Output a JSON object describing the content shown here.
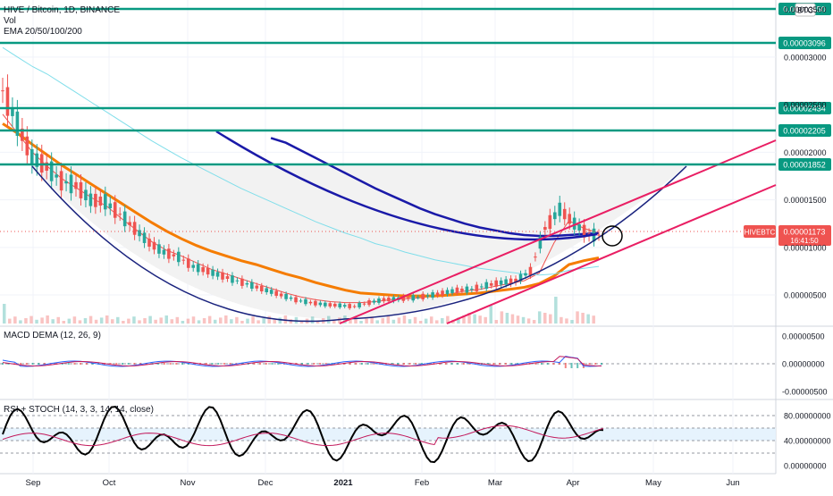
{
  "header": {
    "symbol_line": "HIVE / Bitcoin, 1D, BINANCE",
    "vol_label": "Vol",
    "ema_label": "EMA 20/50/100/200",
    "currency_badge": "BTC"
  },
  "macd_panel": {
    "title": "MACD DEMA (12, 26, 9)",
    "ticks": [
      "0.00000500",
      "0.00000000",
      "-0.00000500"
    ]
  },
  "rsi_panel": {
    "title": "RSI + STOCH (14, 3, 3, 14, 14, close)",
    "ticks": [
      "80.00000000",
      "40.00000000",
      "0.00000000"
    ]
  },
  "price_axis": {
    "ticks": [
      "0.00003500",
      "0.00003000",
      "0.00002500",
      "0.00002000",
      "0.00001500",
      "0.00001000",
      "0.00000500"
    ]
  },
  "horizontal_levels": [
    {
      "label": "0.00003650",
      "value": 3.65e-05
    },
    {
      "label": "0.00003096",
      "value": 3.096e-05
    },
    {
      "label": "0.00002434",
      "value": 2.434e-05
    },
    {
      "label": "0.00002205",
      "value": 2.205e-05
    },
    {
      "label": "0.00001852",
      "value": 1.852e-05
    }
  ],
  "current_price": {
    "symbol": "HIVEBTC",
    "value_label": "0.00001173",
    "countdown": "16:41:50",
    "value": 1.173e-05
  },
  "time_axis": {
    "labels": [
      "Sep",
      "Oct",
      "Nov",
      "Dec",
      "2021",
      "Feb",
      "Mar",
      "Apr",
      "May",
      "Jun"
    ]
  },
  "colors": {
    "level_line": "#089981",
    "level_label_bg": "#089981",
    "channel": "#e91e63",
    "curve": "#1a237e",
    "ema20": "#ef5350",
    "ema50": "#f57c00",
    "ema100": "#80deea",
    "ema200": "#1a1aa8",
    "up": "#26a69a",
    "down": "#ef5350",
    "price_badge": "#ef5350",
    "stoch": "#000000",
    "rsi": "#c2185b"
  },
  "chart_data": {
    "type": "line",
    "title": "HIVE / Bitcoin, 1D, BINANCE",
    "x_label_axis": [
      "Sep",
      "Oct",
      "Nov",
      "Dec",
      "2021",
      "Feb",
      "Mar",
      "Apr",
      "May",
      "Jun"
    ],
    "ylim": [
      2e-06,
      3.6e-05
    ],
    "price_close_approx": [
      2.65e-05,
      2.3e-05,
      1.95e-05,
      1.85e-05,
      1.7e-05,
      1.65e-05,
      1.5e-05,
      1.48e-05,
      1.35e-05,
      1.2e-05,
      1.05e-05,
      9.5e-06,
      9e-06,
      8e-06,
      7.5e-06,
      7e-06,
      6.5e-06,
      6e-06,
      5.5e-06,
      5e-06,
      4.5e-06,
      4.2e-06,
      4e-06,
      3.9e-06,
      3.8e-06,
      4.2e-06,
      4.5e-06,
      4.6e-06,
      4.7e-06,
      4.9e-06,
      5.2e-06,
      5.5e-06,
      5.6e-06,
      6e-06,
      6.3e-06,
      6.5e-06,
      7.5e-06,
      1.2e-05,
      1.4e-05,
      1.25e-05,
      1.13e-05
    ],
    "series": [
      {
        "name": "EMA 20",
        "values": [
          2.4e-05,
          2.2e-05,
          2e-05,
          1.85e-05,
          1.72e-05,
          1.62e-05,
          1.52e-05,
          1.43e-05,
          1.3e-05,
          1.18e-05,
          1.06e-05,
          9.7e-06,
          9.1e-06,
          8.4e-06,
          7.7e-06,
          7.2e-06,
          6.7e-06,
          6.2e-06,
          5.7e-06,
          5.2e-06,
          4.8e-06,
          4.5e-06,
          4.3e-06,
          4.2e-06,
          4.2e-06,
          4.3e-06,
          4.5e-06,
          4.6e-06,
          4.7e-06,
          4.9e-06,
          5.1e-06,
          5.4e-06,
          5.6e-06,
          5.9e-06,
          6.2e-06,
          6.5e-06,
          7.3e-06,
          1.05e-05,
          1.28e-05,
          1.2e-05,
          1.15e-05
        ]
      },
      {
        "name": "EMA 50",
        "values": [
          2.3e-05,
          2.2e-05,
          2.08e-05,
          1.97e-05,
          1.86e-05,
          1.76e-05,
          1.66e-05,
          1.56e-05,
          1.46e-05,
          1.36e-05,
          1.26e-05,
          1.17e-05,
          1.09e-05,
          1.02e-05,
          9.6e-06,
          9.1e-06,
          8.6e-06,
          8.2e-06,
          7.7e-06,
          7.2e-06,
          6.8e-06,
          6.3e-06,
          5.9e-06,
          5.5e-06,
          5.2e-06,
          5.1e-06,
          5e-06,
          4.9e-06,
          4.9e-06,
          4.9e-06,
          5e-06,
          5.1e-06,
          5.2e-06,
          5.4e-06,
          5.6e-06,
          5.8e-06,
          6.2e-06,
          7e-06,
          8.2e-06,
          8.6e-06,
          8.9e-06
        ]
      },
      {
        "name": "EMA 100",
        "values": [
          3.1e-05,
          3e-05,
          2.9e-05,
          2.82e-05,
          2.72e-05,
          2.62e-05,
          2.52e-05,
          2.42e-05,
          2.32e-05,
          2.22e-05,
          2.12e-05,
          2.03e-05,
          1.94e-05,
          1.86e-05,
          1.78e-05,
          1.7e-05,
          1.62e-05,
          1.55e-05,
          1.48e-05,
          1.41e-05,
          1.34e-05,
          1.27e-05,
          1.21e-05,
          1.15e-05,
          1.1e-05,
          1.04e-05,
          1e-05,
          9.5e-06,
          9.1e-06,
          8.7e-06,
          8.4e-06,
          8.1e-06,
          7.8e-06,
          7.6e-06,
          7.4e-06,
          7.2e-06,
          7.1e-06,
          7.2e-06,
          7.6e-06,
          7.8e-06,
          8e-06
        ]
      },
      {
        "name": "EMA 200",
        "values": [
          null,
          null,
          null,
          null,
          null,
          null,
          null,
          null,
          null,
          null,
          null,
          null,
          null,
          null,
          null,
          null,
          null,
          null,
          2.15e-05,
          2.1e-05,
          2.02e-05,
          1.94e-05,
          1.86e-05,
          1.78e-05,
          1.7e-05,
          1.62e-05,
          1.55e-05,
          1.48e-05,
          1.41e-05,
          1.35e-05,
          1.3e-05,
          1.25e-05,
          1.21e-05,
          1.18e-05,
          1.15e-05,
          1.13e-05,
          1.12e-05,
          1.12e-05,
          1.13e-05,
          1.14e-05,
          1.15e-05
        ]
      }
    ]
  }
}
